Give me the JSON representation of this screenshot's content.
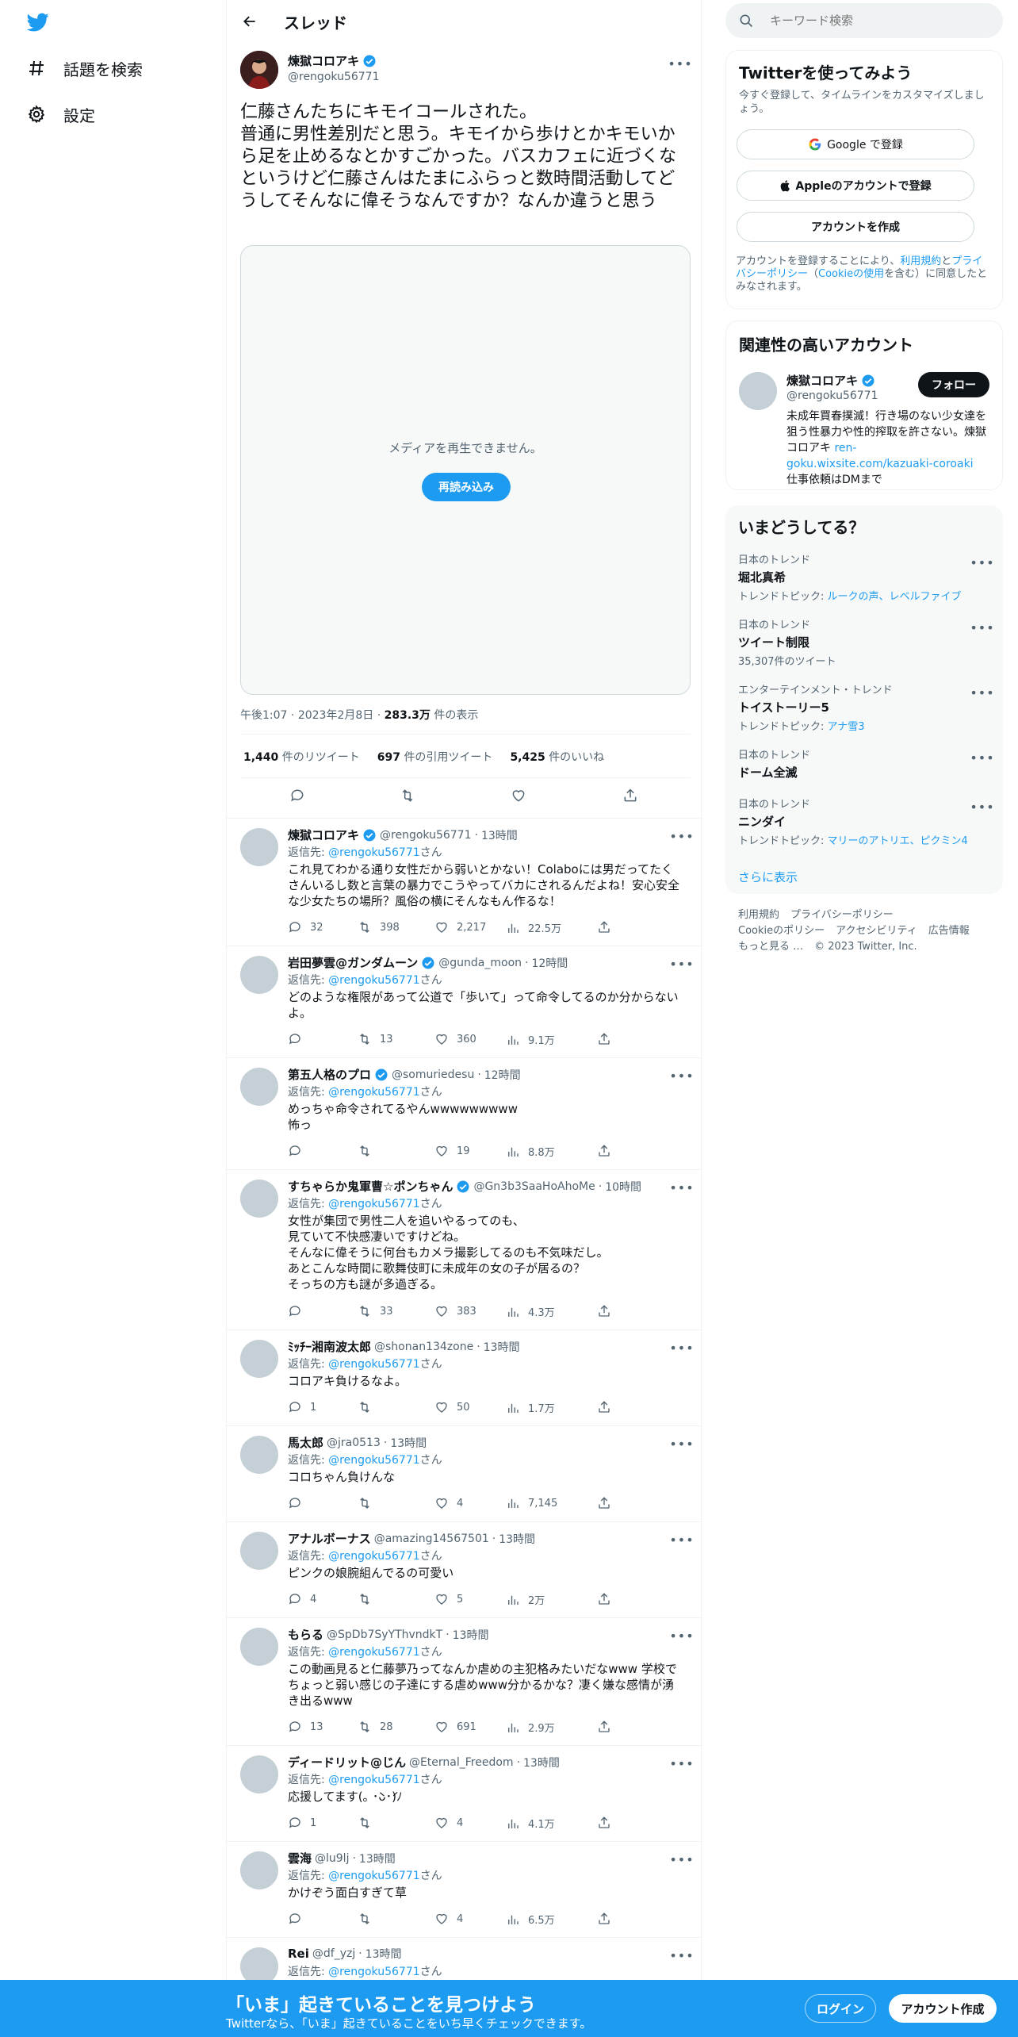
{
  "nav": {
    "explore_label": "話題を検索",
    "settings_label": "設定"
  },
  "header": {
    "title": "スレッド"
  },
  "tweet": {
    "name": "煉獄コロアキ",
    "handle": "@rengoku56771",
    "text": "仁藤さんたちにキモイコールされた。\n普通に男性差別だと思う。キモイから歩けとかキモいから足を止めるなとかすごかった。バスカフェに近づくなというけど仁藤さんはたまにふらっと数時間活動してどうしてそんなに偉そうなんですか？なんか違うと思う",
    "media_message": "メディアを再生できません。",
    "reload_label": "再読み込み",
    "time": "午後1:07",
    "date": "2023年2月8日",
    "views_value": "283.3万",
    "views_label": "件の表示",
    "retweets_value": "1,440",
    "retweets_label": "件のリツイート",
    "quotes_value": "697",
    "quotes_label": "件の引用ツイート",
    "likes_value": "5,425",
    "likes_label": "件のいいね"
  },
  "reply_to_label": "返信先:",
  "reply_to_handle": "@rengoku56771",
  "reply_to_suffix": "さん",
  "replies": [
    {
      "name": "煉獄コロアキ",
      "verified": true,
      "handle": "@rengoku56771",
      "time": "13時間",
      "text": "これ見てわかる通り女性だから弱いとかない！Colaboには男だってたくさんいるし数と言葉の暴力でこうやってバカにされるんだよね！安心安全な少女たちの場所？風俗の横にそんなもん作るな！",
      "replies": "32",
      "retweets": "398",
      "likes": "2,217",
      "views": "22.5万"
    },
    {
      "name": "岩田夢雲@ガンダムーン",
      "verified": true,
      "handle": "@gunda_moon",
      "time": "12時間",
      "text": "どのような権限があって公道で「歩いて」って命令してるのか分からないよ。",
      "replies": "",
      "retweets": "13",
      "likes": "360",
      "views": "9.1万"
    },
    {
      "name": "第五人格のプロ",
      "verified": true,
      "handle": "@somuriedesu",
      "time": "12時間",
      "text": "めっちゃ命令されてるやんwwwwwwwww\n怖っ",
      "replies": "",
      "retweets": "",
      "likes": "19",
      "views": "8.8万"
    },
    {
      "name": "すちゃらか鬼軍曹☆ポンちゃん",
      "verified": true,
      "handle": "@Gn3b3SaaHoAhoMe",
      "time": "10時間",
      "text": "女性が集団で男性二人を追いやるってのも、\n見ていて不快感凄いですけどね。\nそんなに偉そうに何台もカメラ撮影してるのも不気味だし。\nあとこんな時間に歌舞伎町に未成年の女の子が居るの？\nそっちの方も謎が多過ぎる。",
      "replies": "",
      "retweets": "33",
      "likes": "383",
      "views": "4.3万"
    },
    {
      "name": "ﾐｯﾁｰ湘南波太郎",
      "verified": false,
      "handle": "@shonan134zone",
      "time": "13時間",
      "text": "コロアキ負けるなよ。",
      "replies": "1",
      "retweets": "",
      "likes": "50",
      "views": "1.7万"
    },
    {
      "name": "馬太郎",
      "verified": false,
      "handle": "@jra0513",
      "time": "13時間",
      "text": "コロちゃん負けんな",
      "replies": "",
      "retweets": "",
      "likes": "4",
      "views": "7,145"
    },
    {
      "name": "アナルボーナス",
      "verified": false,
      "handle": "@amazing14567501",
      "time": "13時間",
      "text": "ピンクの娘腕組んでるの可愛い",
      "replies": "4",
      "retweets": "",
      "likes": "5",
      "views": "2万"
    },
    {
      "name": "もらる",
      "verified": false,
      "handle": "@SpDb7SyYThvndkT",
      "time": "13時間",
      "text": "この動画見ると仁藤夢乃ってなんか虐めの主犯格みたいだなwww 学校でちょっと弱い感じの子達にする虐めwww分かるかな？凄く嫌な感情が湧き出るwww",
      "replies": "13",
      "retweets": "28",
      "likes": "691",
      "views": "2.9万"
    },
    {
      "name": "ディードリット@じん",
      "verified": false,
      "handle": "@Eternal_Freedom",
      "time": "13時間",
      "text": "応援してます(｡ ･̀ᴗ･́)ﾉ",
      "replies": "1",
      "retweets": "",
      "likes": "4",
      "views": "4.1万"
    },
    {
      "name": "雲海",
      "verified": false,
      "handle": "@lu9lj",
      "time": "13時間",
      "text": "かけぞう面白すぎて草",
      "replies": "",
      "retweets": "",
      "likes": "4",
      "views": "6.5万"
    },
    {
      "name": "Rei",
      "verified": false,
      "handle": "@df_yzj",
      "time": "13時間",
      "text": "",
      "replies": "",
      "retweets": "",
      "likes": "",
      "views": ""
    }
  ],
  "search": {
    "placeholder": "キーワード検索"
  },
  "signup_card": {
    "title": "Twitterを使ってみよう",
    "subtitle": "今すぐ登録して、タイムラインをカスタマイズしましょう。",
    "google_label": "Google で登録",
    "apple_label": "Appleのアカウントで登録",
    "create_label": "アカウントを作成",
    "note_prefix": "アカウントを登録することにより、",
    "note_terms": "利用規約",
    "note_and": "と",
    "note_privacy": "プライバシーポリシー",
    "note_paren_open": "（",
    "note_cookie": "Cookieの使用",
    "note_suffix": "を含む）に同意したとみなされます。"
  },
  "related_card": {
    "title": "関連性の高いアカウント",
    "name": "煉獄コロアキ",
    "handle": "@rengoku56771",
    "follow_label": "フォロー",
    "bio_text": "未成年買春撲滅！行き場のない少女達を狙う性暴力や性的搾取を許さない。煉獄コロアキ ",
    "bio_link": "ren-goku.wixsite.com/kazuaki-coroaki",
    "bio_tail": "\n仕事依頼はDMまで"
  },
  "trends_card": {
    "title": "いまどうしてる？",
    "trends": [
      {
        "context": "日本のトレンド",
        "name": "堀北真希",
        "topic_label": "トレンドトピック: ",
        "topic": "ルークの声、レベルファイブ"
      },
      {
        "context": "日本のトレンド",
        "name": "ツイート制限",
        "topic_label": "",
        "topic": "35,307件のツイート"
      },
      {
        "context": "エンターテインメント・トレンド",
        "name": "トイストーリー5",
        "topic_label": "トレンドトピック: ",
        "topic": "アナ雪3"
      },
      {
        "context": "日本のトレンド",
        "name": "ドーム全滅",
        "topic_label": "",
        "topic": ""
      },
      {
        "context": "日本のトレンド",
        "name": "ニンダイ",
        "topic_label": "トレンドトピック: ",
        "topic": "マリーのアトリエ、ピクミン4"
      }
    ],
    "show_more": "さらに表示"
  },
  "footer": {
    "terms": "利用規約",
    "privacy": "プライバシーポリシー",
    "cookie": "Cookieのポリシー",
    "accessibility": "アクセシビリティ",
    "ads": "広告情報",
    "more": "もっと見る …",
    "copyright": "© 2023 Twitter, Inc."
  },
  "bottom_bar": {
    "title": "「いま」起きていることを見つけよう",
    "subtitle": "Twitterなら、「いま」起きていることをいち早くチェックできます。",
    "login_label": "ログイン",
    "signup_label": "アカウント作成"
  }
}
